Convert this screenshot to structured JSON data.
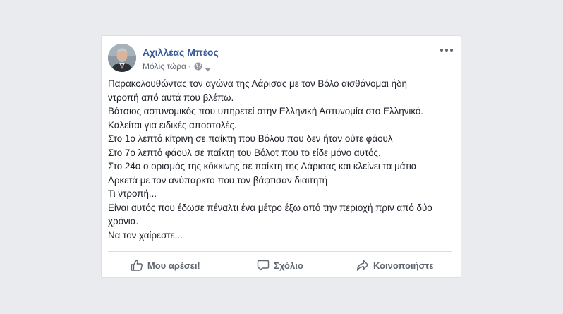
{
  "post": {
    "author": "Αχιλλέας Μπέος",
    "timestamp": "Μόλις τώρα",
    "separator": "·",
    "audience_icon": "globe-icon",
    "menu_icon": "more-options-icon",
    "lines": [
      "Παρακολουθώντας τον αγώνα της Λάρισας με τον Βόλο αισθάνομαι ήδη",
      "ντροπή από αυτά που βλέπω.",
      "Βάτσιος αστυνομικός που υπηρετεί στην Ελληνική Αστυνομία στο Ελληνικό.",
      "Καλείται για ειδικές αποστολές.",
      "Στο 1ο λεπτό κίτρινη σε παίκτη που Βόλου που δεν ήταν ούτε φάουλ",
      "Στο 7ο λεπτό φάουλ σε παίκτη του Βόλοτ που το είδε μόνο αυτός.",
      "Στο 24ο ο ορισμός της κόκκινης σε παίκτη της Λάρισας και κλείνει τα μάτια",
      "Αρκετά με τον ανύπαρκτο που τον βάφτισαν διαιτητή",
      "Τι ντροπή...",
      "Είναι αυτός που έδωσε πέναλτι ένα μέτρο έξω από την περιοχή πριν από δύο",
      "χρόνια.",
      "Να τον χαίρεστε..."
    ]
  },
  "actions": {
    "like_label": "Μου αρέσει!",
    "comment_label": "Σχόλιο",
    "share_label": "Κοινοποιήστε",
    "like_icon": "thumbs-up-icon",
    "comment_icon": "comment-icon",
    "share_icon": "share-icon"
  },
  "colors": {
    "author_link": "#365899",
    "text": "#1d2129",
    "secondary_text": "#616770",
    "action_text": "#606770",
    "page_background": "#e9ebee",
    "card_background": "#ffffff"
  }
}
